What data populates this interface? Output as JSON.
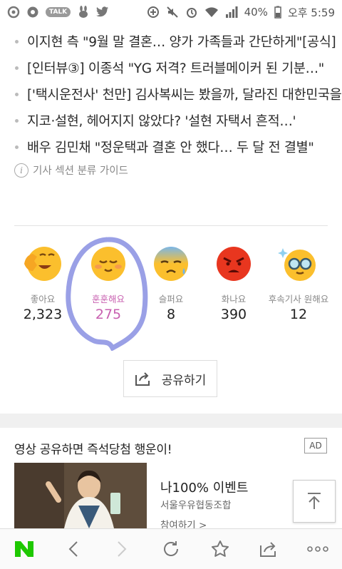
{
  "status_bar": {
    "battery": "40%",
    "time": "오후 5:59",
    "talk_badge": "TALK"
  },
  "headlines": [
    "이지현 측 \"9월 말 결혼… 양가 가족들과 간단하게\"[공식]",
    "[인터뷰③] 이종석 \"YG 저격? 트러블메이커 된 기분…\"",
    "['택시운전사' 천만] 김사복씨는 봤을까, 달라진 대한민국을",
    "지코·설현, 헤어지지 않았다? '설현 자택서 흔적…'",
    "배우 김민채 \"정운택과 결혼 안 했다… 두 달 전 결별\""
  ],
  "section_guide": {
    "label": "기사 섹션 분류 가이드",
    "icon": "info-icon"
  },
  "reactions": [
    {
      "label": "좋아요",
      "count": "2,323",
      "icon": "clapping-emoji-icon"
    },
    {
      "label": "훈훈해요",
      "count": "275",
      "icon": "warm-smile-emoji-icon",
      "selected": true
    },
    {
      "label": "슬퍼요",
      "count": "8",
      "icon": "sad-emoji-icon"
    },
    {
      "label": "화나요",
      "count": "390",
      "icon": "angry-emoji-icon"
    },
    {
      "label": "후속기사 원해요",
      "count": "12",
      "icon": "glasses-emoji-icon"
    }
  ],
  "share": {
    "label": "공유하기",
    "icon": "share-icon"
  },
  "ad": {
    "title": "영상 공유하면 즉석당첨 행운이!",
    "badge": "AD",
    "name": "나100% 이벤트",
    "sponsor": "서울우유협동조합",
    "cta": "참여하기 >"
  },
  "bottom_nav": [
    "naver-logo-icon",
    "back-icon",
    "forward-icon",
    "refresh-icon",
    "bookmark-star-icon",
    "share-icon",
    "more-icon"
  ],
  "colors": {
    "selected_reaction": "#c860b0",
    "highlight_circle": "#9aa0e6",
    "naver_green": "#1ec800"
  }
}
